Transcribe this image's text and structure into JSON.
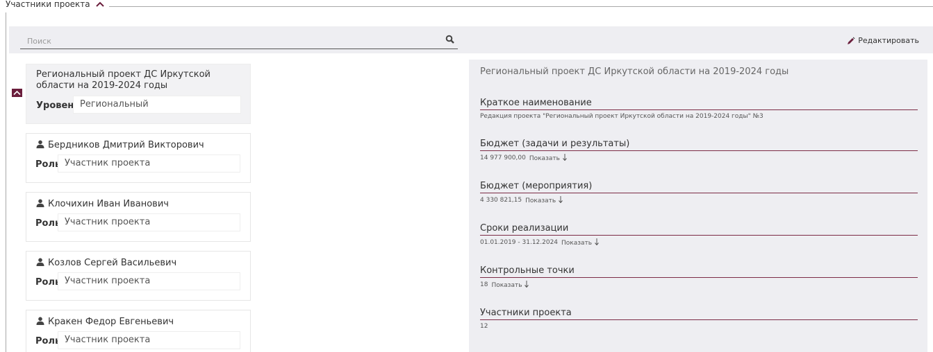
{
  "section": {
    "title": "Участники проекта"
  },
  "toolbar": {
    "search_placeholder": "Поиск",
    "edit_label": "Редактировать"
  },
  "org_card": {
    "name": "Региональный проект ДС Иркутской области на 2019-2024 годы",
    "level_label": "Уровень",
    "level_value": "Региональный"
  },
  "members": [
    {
      "name": "Бердников Дмитрий Викторович",
      "role_label": "Роль",
      "role_value": "Участник проекта"
    },
    {
      "name": "Клочихин Иван Иванович",
      "role_label": "Роль",
      "role_value": "Участник проекта"
    },
    {
      "name": "Козлов Сергей Васильевич",
      "role_label": "Роль",
      "role_value": "Участник проекта"
    },
    {
      "name": "Кракен Федор Евгеньевич",
      "role_label": "Роль",
      "role_value": "Участник проекта"
    }
  ],
  "details": {
    "title": "Региональный проект ДС Иркутской области на 2019-2024 годы",
    "items": [
      {
        "label": "Краткое наименование",
        "value": "Редакция проекта \"Региональный проект Иркутской области на 2019-2024 годы\" №3",
        "show": ""
      },
      {
        "label": "Бюджет (задачи и результаты)",
        "value": "14 977 900,00",
        "show": "Показать"
      },
      {
        "label": "Бюджет (мероприятия)",
        "value": "4 330 821,15",
        "show": "Показать"
      },
      {
        "label": "Сроки реализации",
        "value": "01.01.2019 - 31.12.2024",
        "show": "Показать"
      },
      {
        "label": "Контрольные точки",
        "value": "18",
        "show": "Показать"
      },
      {
        "label": "Участники проекта",
        "value": "12",
        "show": ""
      }
    ]
  },
  "colors": {
    "accent": "#6b1e3c",
    "panel_bg": "#eeeef2",
    "underline": "#7b2a45"
  },
  "icons": [
    "chevron-up-icon",
    "search-icon",
    "pencil-icon",
    "collapse-icon",
    "user-icon",
    "arrow-down-icon"
  ]
}
